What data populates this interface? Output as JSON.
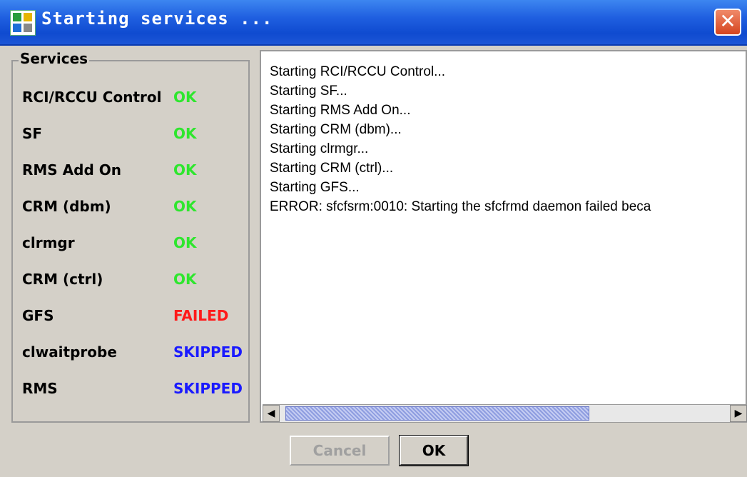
{
  "window": {
    "title": "Starting services ..."
  },
  "services": {
    "title": "Services",
    "items": [
      {
        "name": "RCI/RCCU Control",
        "status": "OK"
      },
      {
        "name": "SF",
        "status": "OK"
      },
      {
        "name": "RMS Add On",
        "status": "OK"
      },
      {
        "name": "CRM (dbm)",
        "status": "OK"
      },
      {
        "name": "clrmgr",
        "status": "OK"
      },
      {
        "name": "CRM (ctrl)",
        "status": "OK"
      },
      {
        "name": "GFS",
        "status": "FAILED"
      },
      {
        "name": "clwaitprobe",
        "status": "SKIPPED"
      },
      {
        "name": "RMS",
        "status": "SKIPPED"
      }
    ]
  },
  "status_colors": {
    "OK": "#2ee62e",
    "FAILED": "#ff1a1a",
    "SKIPPED": "#1a1aff"
  },
  "log": {
    "lines": [
      "Starting RCI/RCCU Control...",
      "Starting SF...",
      "Starting RMS Add On...",
      "Starting CRM (dbm)...",
      "Starting clrmgr...",
      "Starting CRM (ctrl)...",
      "Starting GFS...",
      "ERROR: sfcfsrm:0010: Starting the sfcfrmd daemon failed beca"
    ]
  },
  "buttons": {
    "cancel": "Cancel",
    "ok": "OK"
  }
}
